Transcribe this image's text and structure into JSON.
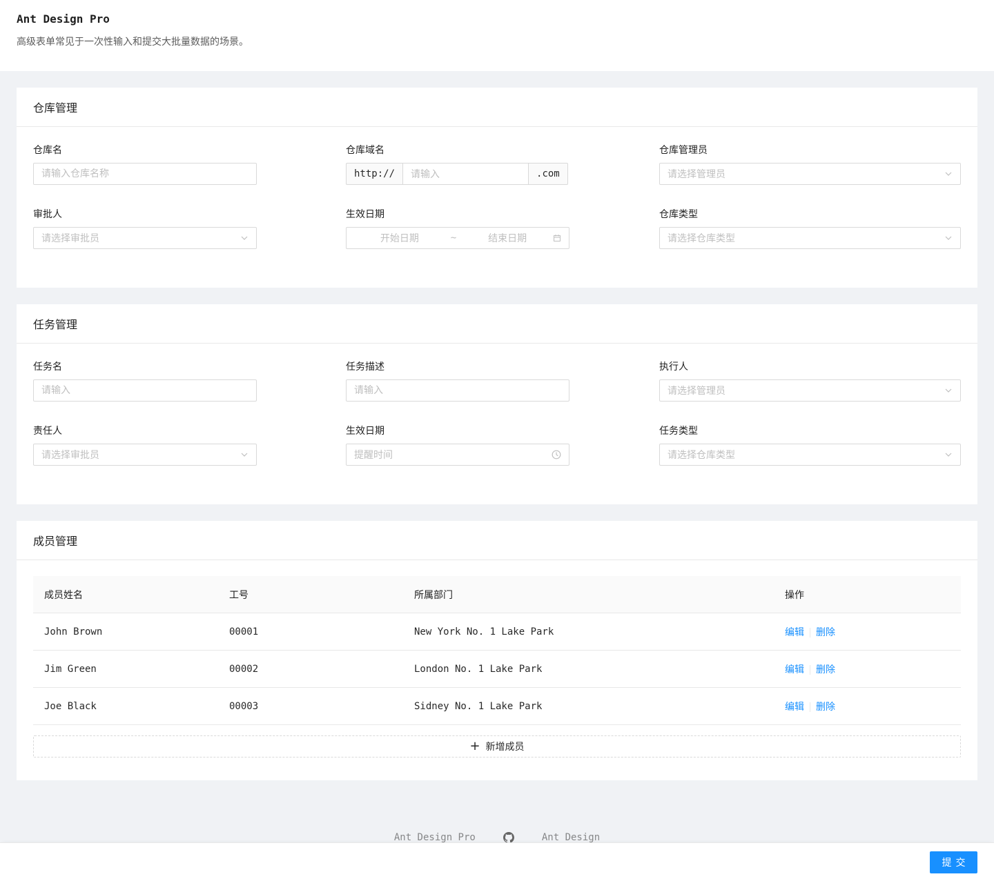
{
  "header": {
    "title": "Ant Design Pro",
    "description": "高级表单常见于一次性输入和提交大批量数据的场景。"
  },
  "warehouse": {
    "title": "仓库管理",
    "name_label": "仓库名",
    "name_placeholder": "请输入仓库名称",
    "domain_label": "仓库域名",
    "domain_prefix": "http://",
    "domain_placeholder": "请输入",
    "domain_suffix": ".com",
    "admin_label": "仓库管理员",
    "admin_placeholder": "请选择管理员",
    "approver_label": "审批人",
    "approver_placeholder": "请选择审批员",
    "date_label": "生效日期",
    "date_start_placeholder": "开始日期",
    "date_sep": "~",
    "date_end_placeholder": "结束日期",
    "type_label": "仓库类型",
    "type_placeholder": "请选择仓库类型"
  },
  "task": {
    "title": "任务管理",
    "name_label": "任务名",
    "name_placeholder": "请输入",
    "desc_label": "任务描述",
    "desc_placeholder": "请输入",
    "executor_label": "执行人",
    "executor_placeholder": "请选择管理员",
    "owner_label": "责任人",
    "owner_placeholder": "请选择审批员",
    "date_label": "生效日期",
    "date_placeholder": "提醒时间",
    "type_label": "任务类型",
    "type_placeholder": "请选择仓库类型"
  },
  "members": {
    "title": "成员管理",
    "columns": [
      "成员姓名",
      "工号",
      "所属部门",
      "操作"
    ],
    "rows": [
      {
        "name": "John Brown",
        "id": "00001",
        "dept": "New York No. 1 Lake Park",
        "edit": "编辑",
        "delete": "删除"
      },
      {
        "name": "Jim Green",
        "id": "00002",
        "dept": "London No. 1 Lake Park",
        "edit": "编辑",
        "delete": "删除"
      },
      {
        "name": "Joe Black",
        "id": "00003",
        "dept": "Sidney No. 1 Lake Park",
        "edit": "编辑",
        "delete": "删除"
      }
    ],
    "add_label": "新增成员"
  },
  "footer": {
    "link_pro": "Ant Design Pro",
    "github_icon": "github-icon",
    "link_ant": "Ant Design",
    "submit_label": "提交"
  },
  "colors": {
    "primary": "#1890ff",
    "background": "#f0f2f5"
  }
}
